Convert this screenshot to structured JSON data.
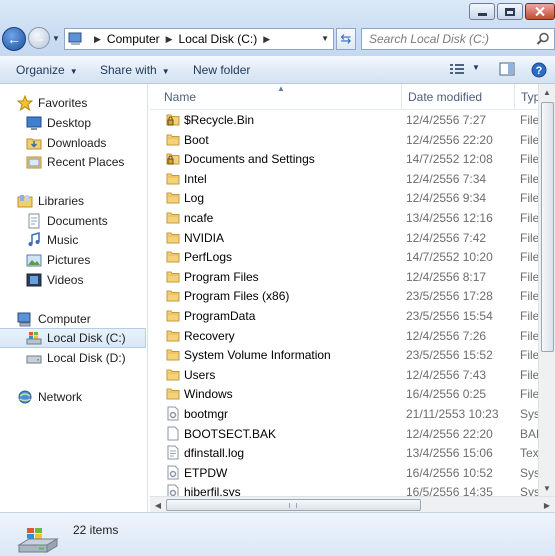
{
  "address": {
    "crumbs": [
      "Computer",
      "Local Disk (C:)"
    ],
    "search_placeholder": "Search Local Disk (C:)"
  },
  "toolbar": {
    "organize": "Organize",
    "share_with": "Share with",
    "new_folder": "New folder"
  },
  "nav": {
    "favorites": "Favorites",
    "desktop": "Desktop",
    "downloads": "Downloads",
    "recent_places": "Recent Places",
    "libraries": "Libraries",
    "documents": "Documents",
    "music": "Music",
    "pictures": "Pictures",
    "videos": "Videos",
    "computer": "Computer",
    "local_c": "Local Disk (C:)",
    "local_d": "Local Disk (D:)",
    "network": "Network"
  },
  "columns": {
    "name": "Name",
    "date": "Date modified",
    "type": "Type"
  },
  "files": [
    {
      "name": "$Recycle.Bin",
      "date": "12/4/2556 7:27",
      "type": "File fo",
      "icon": "locked-folder-icon"
    },
    {
      "name": "Boot",
      "date": "12/4/2556 22:20",
      "type": "File fo",
      "icon": "folder-icon"
    },
    {
      "name": "Documents and Settings",
      "date": "14/7/2552 12:08",
      "type": "File fo",
      "icon": "locked-folder-icon"
    },
    {
      "name": "Intel",
      "date": "12/4/2556 7:34",
      "type": "File fo",
      "icon": "folder-icon"
    },
    {
      "name": "Log",
      "date": "12/4/2556 9:34",
      "type": "File fo",
      "icon": "folder-icon"
    },
    {
      "name": "ncafe",
      "date": "13/4/2556 12:16",
      "type": "File fo",
      "icon": "folder-icon"
    },
    {
      "name": "NVIDIA",
      "date": "12/4/2556 7:42",
      "type": "File fo",
      "icon": "folder-icon"
    },
    {
      "name": "PerfLogs",
      "date": "14/7/2552 10:20",
      "type": "File fo",
      "icon": "folder-icon"
    },
    {
      "name": "Program Files",
      "date": "12/4/2556 8:17",
      "type": "File fo",
      "icon": "folder-icon"
    },
    {
      "name": "Program Files (x86)",
      "date": "23/5/2556 17:28",
      "type": "File fo",
      "icon": "folder-icon"
    },
    {
      "name": "ProgramData",
      "date": "23/5/2556 15:54",
      "type": "File fo",
      "icon": "folder-icon"
    },
    {
      "name": "Recovery",
      "date": "12/4/2556 7:26",
      "type": "File fo",
      "icon": "folder-icon"
    },
    {
      "name": "System Volume Information",
      "date": "23/5/2556 15:52",
      "type": "File fo",
      "icon": "folder-icon"
    },
    {
      "name": "Users",
      "date": "12/4/2556 7:43",
      "type": "File fo",
      "icon": "folder-icon"
    },
    {
      "name": "Windows",
      "date": "16/4/2556 0:25",
      "type": "File fo",
      "icon": "folder-icon"
    },
    {
      "name": "bootmgr",
      "date": "21/11/2553 10:23",
      "type": "Syster",
      "icon": "system-file-icon"
    },
    {
      "name": "BOOTSECT.BAK",
      "date": "12/4/2556 22:20",
      "type": "BAK F",
      "icon": "file-icon"
    },
    {
      "name": "dfinstall.log",
      "date": "13/4/2556 15:06",
      "type": "Text D",
      "icon": "text-file-icon"
    },
    {
      "name": "ETPDW",
      "date": "16/4/2556 10:52",
      "type": "Syster",
      "icon": "system-file-icon"
    },
    {
      "name": "hiberfil.sys",
      "date": "16/5/2556 14:35",
      "type": "Syster",
      "icon": "system-file-icon"
    }
  ],
  "details": {
    "count": "22 items"
  }
}
